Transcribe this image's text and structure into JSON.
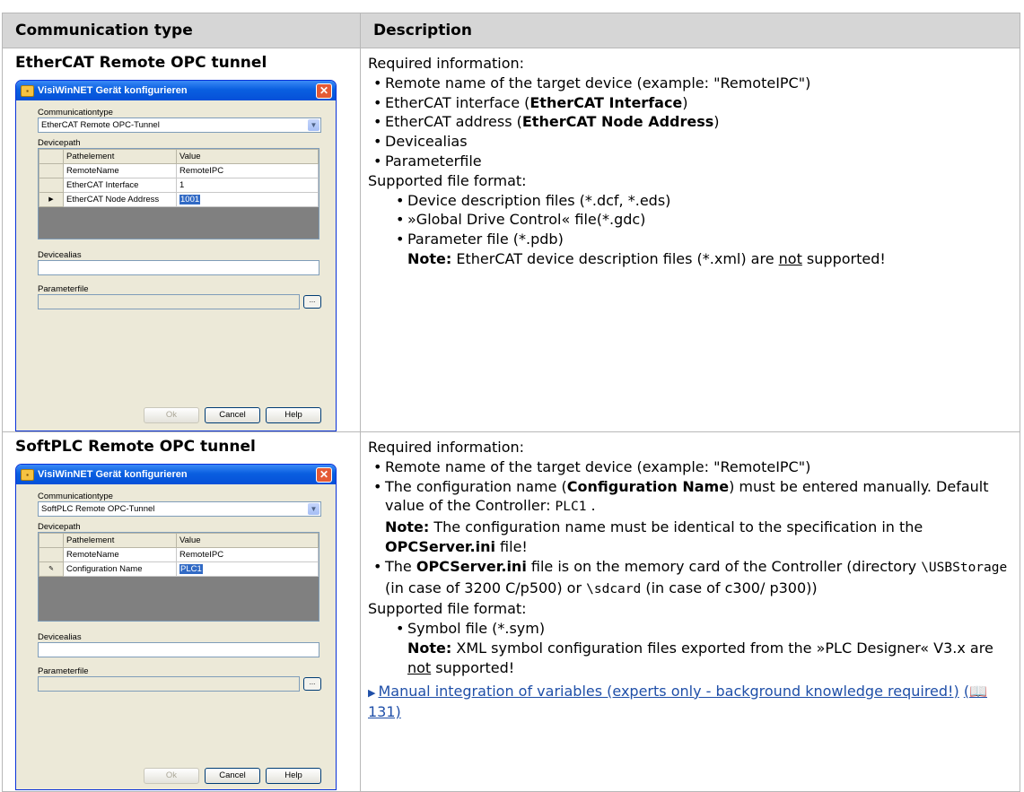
{
  "header": {
    "col1": "Communication type",
    "col2": "Description"
  },
  "rows": [
    {
      "type_title": "EtherCAT Remote OPC tunnel",
      "dialog": {
        "title": "VisiWinNET Gerät konfigurieren",
        "comm_label": "Communicationtype",
        "comm_value": "EtherCAT Remote OPC-Tunnel",
        "devicepath_label": "Devicepath",
        "col_pathelement": "Pathelement",
        "col_value": "Value",
        "grid_rows": [
          {
            "marker": "",
            "element": "RemoteName",
            "value": "RemoteIPC"
          },
          {
            "marker": "",
            "element": "EtherCAT Interface",
            "value": "1"
          },
          {
            "marker": "▶",
            "element": "EtherCAT Node Address",
            "value": "1001"
          }
        ],
        "devicealias_label": "Devicealias",
        "parameterfile_label": "Parameterfile",
        "browse_label": "...",
        "ok_label": "Ok",
        "cancel_label": "Cancel",
        "help_label": "Help"
      },
      "desc": {
        "required_info": "Required information:",
        "b1": "Remote name of the target device (example: \"RemoteIPC\")",
        "b2_pre": "EtherCAT interface (",
        "b2_bold": "EtherCAT Interface",
        "b2_post": ")",
        "b3_pre": "EtherCAT address (",
        "b3_bold": "EtherCAT Node Address",
        "b3_post": ")",
        "b4": "Devicealias",
        "b5": "Parameterfile",
        "supported": "Supported file format:",
        "f1": "Device description files (*.dcf, *.eds)",
        "f2": "»Global Drive Control« file(*.gdc)",
        "f3": "Parameter file (*.pdb)",
        "note_label": "Note:",
        "note_pre": " EtherCAT device description files (*.xml) are ",
        "note_u": "not",
        "note_post": " supported!"
      }
    },
    {
      "type_title": "SoftPLC Remote OPC tunnel",
      "dialog": {
        "title": "VisiWinNET Gerät konfigurieren",
        "comm_label": "Communicationtype",
        "comm_value": "SoftPLC Remote OPC-Tunnel",
        "devicepath_label": "Devicepath",
        "col_pathelement": "Pathelement",
        "col_value": "Value",
        "grid_rows": [
          {
            "marker": "",
            "element": "RemoteName",
            "value": "RemoteIPC"
          },
          {
            "marker": "✎",
            "element": "Configuration Name",
            "value": "PLC1"
          }
        ],
        "devicealias_label": "Devicealias",
        "parameterfile_label": "Parameterfile",
        "browse_label": "...",
        "ok_label": "Ok",
        "cancel_label": "Cancel",
        "help_label": "Help"
      },
      "desc": {
        "required_info": "Required information:",
        "b1": "Remote name of the target device (example: \"RemoteIPC\")",
        "b2_pre": "The configuration name (",
        "b2_bold": "Configuration Name",
        "b2_post": ") must be entered manually. Default value of the Controller: ",
        "b2_code": "PLC1",
        "b2_end": " .",
        "note1_label": "Note:",
        "note1_pre": " The configuration name must be identical to the specification in the ",
        "note1_bold": "OPCServer.ini",
        "note1_post": " file!",
        "b3_pre": "The ",
        "b3_bold": "OPCServer.ini",
        "b3_mid1": " file is on the memory card of the Controller (directory ",
        "b3_code1": "\\USBStorage",
        "b3_mid2": " (in case of 3200 C/p500) or ",
        "b3_code2": "\\sdcard",
        "b3_post": " (in case of c300/ p300))",
        "supported": "Supported file format:",
        "f1": "Symbol file (*.sym)",
        "note2_label": "Note:",
        "note2_pre": " XML symbol configuration files exported from the »PLC Designer« V3.x are ",
        "note2_u": "not",
        "note2_post": " supported!",
        "link_text": "Manual integration of variables (experts only - background knowledge required!)",
        "link_ref": "(📖 131)"
      }
    }
  ]
}
